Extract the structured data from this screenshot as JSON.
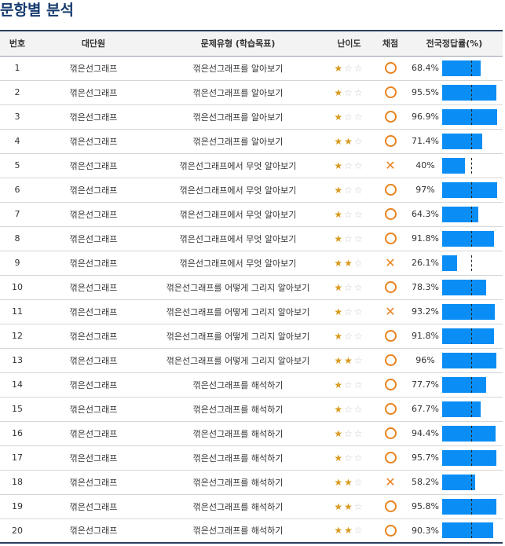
{
  "page_title": "문항별 분석",
  "columns": {
    "number": "번호",
    "unit": "대단원",
    "type": "문제유형 (학습목표)",
    "difficulty": "난이도",
    "grading": "채점",
    "rate": "전국정답률(%)"
  },
  "colors": {
    "title": "#173b6e",
    "bar": "#0a8ef5",
    "star_on": "#d99a1e",
    "mark": "#e8831e",
    "header_border": "#2a3f60"
  },
  "rows": [
    {
      "num": "1",
      "unit": "꺾은선그래프",
      "type": "꺾은선그래프를 알아보기",
      "stars": 1,
      "result": "correct",
      "rate_label": "68.4%",
      "rate": 68.4
    },
    {
      "num": "2",
      "unit": "꺾은선그래프",
      "type": "꺾은선그래프를 알아보기",
      "stars": 1,
      "result": "correct",
      "rate_label": "95.5%",
      "rate": 95.5
    },
    {
      "num": "3",
      "unit": "꺾은선그래프",
      "type": "꺾은선그래프를 알아보기",
      "stars": 1,
      "result": "correct",
      "rate_label": "96.9%",
      "rate": 96.9
    },
    {
      "num": "4",
      "unit": "꺾은선그래프",
      "type": "꺾은선그래프를 알아보기",
      "stars": 2,
      "result": "correct",
      "rate_label": "71.4%",
      "rate": 71.4
    },
    {
      "num": "5",
      "unit": "꺾은선그래프",
      "type": "꺾은선그래프에서 무엇 알아보기",
      "stars": 1,
      "result": "wrong",
      "rate_label": "40%",
      "rate": 40
    },
    {
      "num": "6",
      "unit": "꺾은선그래프",
      "type": "꺾은선그래프에서 무엇 알아보기",
      "stars": 1,
      "result": "correct",
      "rate_label": "97%",
      "rate": 97
    },
    {
      "num": "7",
      "unit": "꺾은선그래프",
      "type": "꺾은선그래프에서 무엇 알아보기",
      "stars": 1,
      "result": "correct",
      "rate_label": "64.3%",
      "rate": 64.3
    },
    {
      "num": "8",
      "unit": "꺾은선그래프",
      "type": "꺾은선그래프에서 무엇 알아보기",
      "stars": 1,
      "result": "correct",
      "rate_label": "91.8%",
      "rate": 91.8
    },
    {
      "num": "9",
      "unit": "꺾은선그래프",
      "type": "꺾은선그래프에서 무엇 알아보기",
      "stars": 2,
      "result": "wrong",
      "rate_label": "26.1%",
      "rate": 26.1
    },
    {
      "num": "10",
      "unit": "꺾은선그래프",
      "type": "꺾은선그래프를 어떻게 그리지 알아보기",
      "stars": 1,
      "result": "correct",
      "rate_label": "78.3%",
      "rate": 78.3
    },
    {
      "num": "11",
      "unit": "꺾은선그래프",
      "type": "꺾은선그래프를 어떻게 그리지 알아보기",
      "stars": 1,
      "result": "wrong",
      "rate_label": "93.2%",
      "rate": 93.2
    },
    {
      "num": "12",
      "unit": "꺾은선그래프",
      "type": "꺾은선그래프를 어떻게 그리지 알아보기",
      "stars": 1,
      "result": "correct",
      "rate_label": "91.8%",
      "rate": 91.8
    },
    {
      "num": "13",
      "unit": "꺾은선그래프",
      "type": "꺾은선그래프를 어떻게 그리지 알아보기",
      "stars": 2,
      "result": "correct",
      "rate_label": "96%",
      "rate": 96
    },
    {
      "num": "14",
      "unit": "꺾은선그래프",
      "type": "꺾은선그래프를 해석하기",
      "stars": 1,
      "result": "correct",
      "rate_label": "77.7%",
      "rate": 77.7
    },
    {
      "num": "15",
      "unit": "꺾은선그래프",
      "type": "꺾은선그래프를 해석하기",
      "stars": 1,
      "result": "correct",
      "rate_label": "67.7%",
      "rate": 67.7
    },
    {
      "num": "16",
      "unit": "꺾은선그래프",
      "type": "꺾은선그래프를 해석하기",
      "stars": 1,
      "result": "correct",
      "rate_label": "94.4%",
      "rate": 94.4
    },
    {
      "num": "17",
      "unit": "꺾은선그래프",
      "type": "꺾은선그래프를 해석하기",
      "stars": 1,
      "result": "correct",
      "rate_label": "95.7%",
      "rate": 95.7
    },
    {
      "num": "18",
      "unit": "꺾은선그래프",
      "type": "꺾은선그래프를 해석하기",
      "stars": 2,
      "result": "wrong",
      "rate_label": "58.2%",
      "rate": 58.2
    },
    {
      "num": "19",
      "unit": "꺾은선그래프",
      "type": "꺾은선그래프를 해석하기",
      "stars": 2,
      "result": "correct",
      "rate_label": "95.8%",
      "rate": 95.8
    },
    {
      "num": "20",
      "unit": "꺾은선그래프",
      "type": "꺾은선그래프를 해석하기",
      "stars": 2,
      "result": "correct",
      "rate_label": "90.3%",
      "rate": 90.3
    }
  ]
}
